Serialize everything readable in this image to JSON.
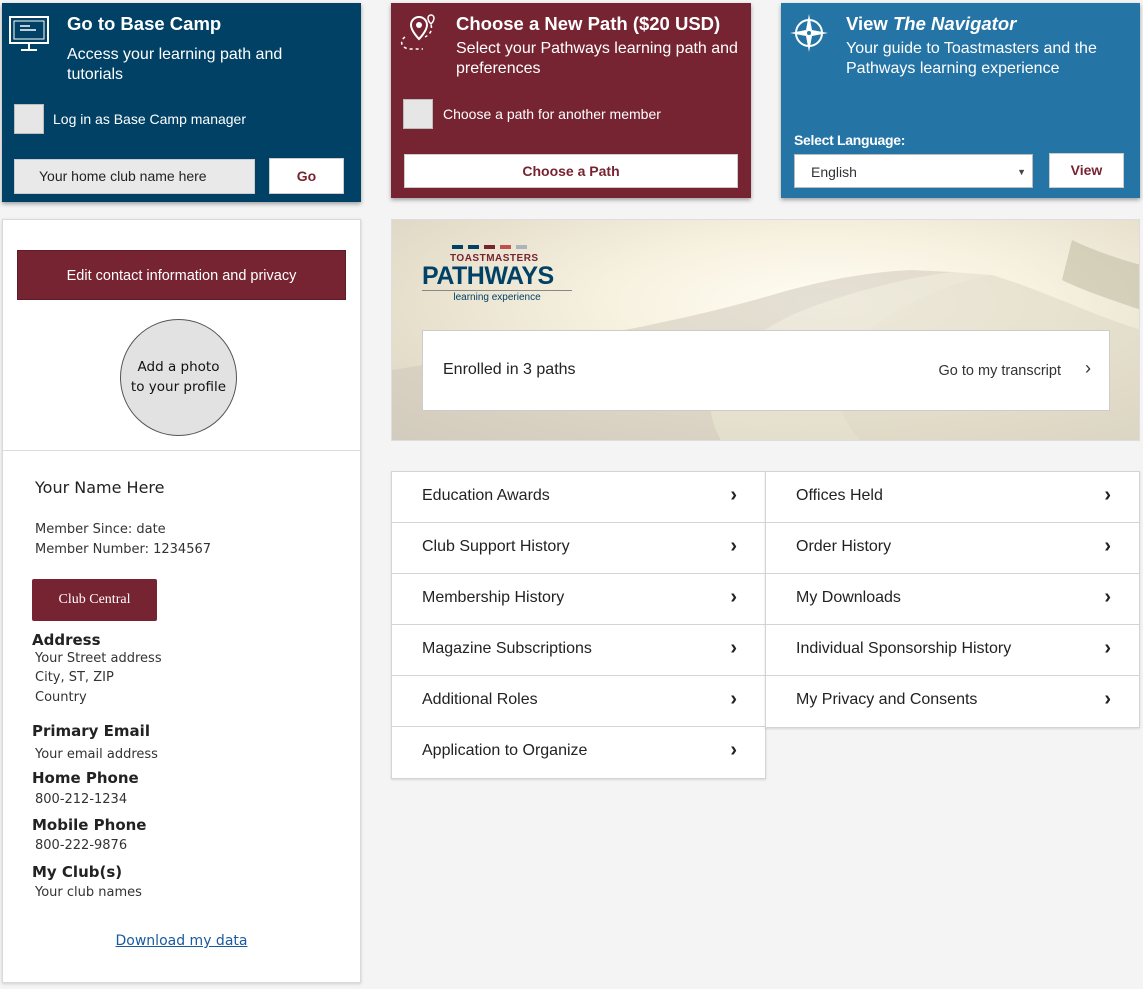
{
  "basecamp": {
    "title": "Go to Base Camp",
    "subtitle": "Access your learning path and tutorials",
    "checkbox_label": "Log in as Base Camp manager",
    "club_input_value": "Your home club name here",
    "go_label": "Go",
    "icon": "computer-monitor-icon"
  },
  "newpath": {
    "title": "Choose a New Path ($20 USD)",
    "subtitle": "Select your Pathways learning path and preferences",
    "checkbox_label": "Choose a path for another member",
    "button_label": "Choose a Path",
    "icon": "map-pin-path-icon"
  },
  "navigator": {
    "title_prefix": "View ",
    "title_emph": "The Navigator",
    "subtitle": "Your guide to Toastmasters and the Pathways learning experience",
    "language_label": "Select Language:",
    "language_value": "English",
    "view_label": "View",
    "icon": "compass-icon"
  },
  "profile": {
    "edit_label": "Edit contact information and privacy",
    "photo_label": "Add a photo to your profile",
    "name": "Your Name Here",
    "member_since": "Member Since: date",
    "member_number": "Member Number: 1234567",
    "club_central_label": "Club Central",
    "address_heading": "Address",
    "address_line1": "Your Street address",
    "address_line2": "City, ST, ZIP",
    "address_line3": "Country",
    "email_heading": "Primary Email",
    "email_value": "Your email address",
    "home_phone_heading": "Home Phone",
    "home_phone_value": "800-212-1234",
    "mobile_phone_heading": "Mobile Phone",
    "mobile_phone_value": "800-222-9876",
    "clubs_heading": "My Club(s)",
    "clubs_value": "Your club names",
    "download_label": "Download my data"
  },
  "pathways": {
    "logo_top": "TOASTMASTERS",
    "logo_main": "PATHWAYS",
    "logo_sub": "learning experience",
    "enrolled_text": "Enrolled in 3 paths",
    "transcript_link": "Go to my transcript",
    "logo_bar_colors": [
      "#004165",
      "#004165",
      "#772432",
      "#c0504d",
      "#a9b4bd"
    ]
  },
  "menu_left": [
    "Education Awards",
    "Club Support History",
    "Membership History",
    "Magazine Subscriptions",
    "Additional Roles",
    "Application to Organize"
  ],
  "menu_right": [
    "Offices Held",
    "Order History",
    "My Downloads",
    "Individual Sponsorship History",
    "My Privacy and Consents"
  ],
  "colors": {
    "navy": "#004165",
    "maroon": "#772432",
    "blue": "#2474a6"
  }
}
